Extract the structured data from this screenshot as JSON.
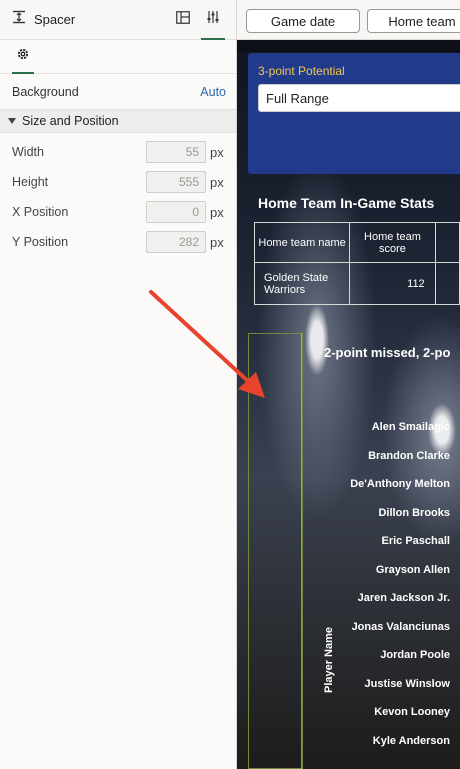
{
  "panel": {
    "title": "Spacer",
    "background_label": "Background",
    "background_value": "Auto",
    "section_title": "Size and Position",
    "props": [
      {
        "label": "Width",
        "value": "55",
        "unit": "px"
      },
      {
        "label": "Height",
        "value": "555",
        "unit": "px"
      },
      {
        "label": "X Position",
        "value": "0",
        "unit": "px"
      },
      {
        "label": "Y Position",
        "value": "282",
        "unit": "px"
      }
    ]
  },
  "toolbar": {
    "btn1": "Game date",
    "btn2": "Home team"
  },
  "filter": {
    "label": "3-point Potential",
    "value": "Full Range"
  },
  "stats": {
    "title": "Home Team In-Game Stats",
    "col1": "Home team name",
    "col2": "Home team score",
    "team": "Golden State Warriors",
    "score": "112"
  },
  "chart": {
    "title": "2-point missed, 2-po",
    "axis_label": "Player Name",
    "players": [
      "Alen Smailagic",
      "Brandon Clarke",
      "De'Anthony Melton",
      "Dillon Brooks",
      "Eric Paschall",
      "Grayson Allen",
      "Jaren Jackson Jr.",
      "Jonas Valanciunas",
      "Jordan Poole",
      "Justise Winslow",
      "Kevon Looney",
      "Kyle Anderson"
    ]
  },
  "colors": {
    "accent_green": "#2f6f4f",
    "link_blue": "#2d6aa8",
    "filter_bg": "#223a8a",
    "filter_label": "#f2c94c",
    "arrow": "#e8432c"
  }
}
